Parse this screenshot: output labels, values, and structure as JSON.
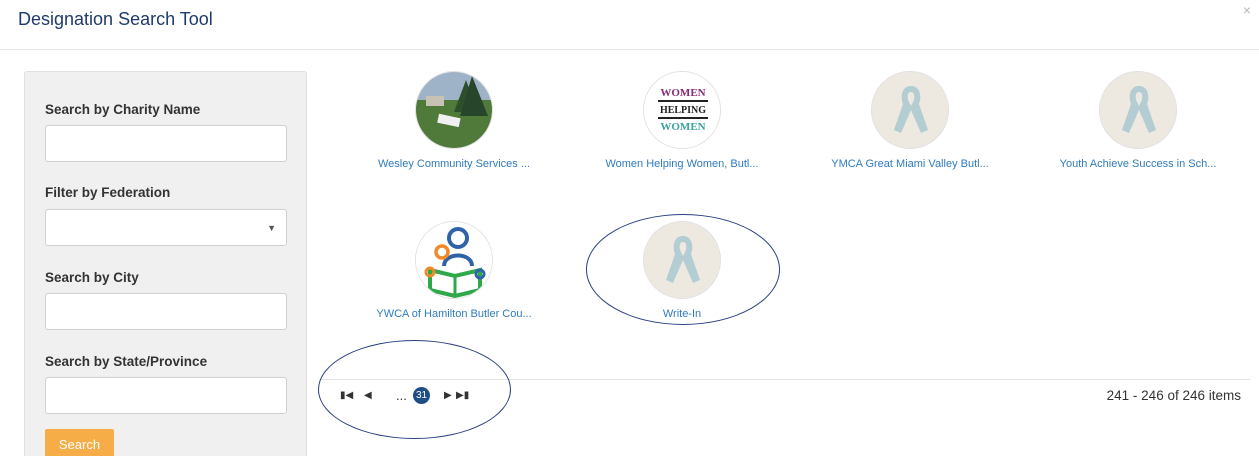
{
  "dialog": {
    "title": "Designation Search Tool",
    "close_label": "×"
  },
  "sidebar": {
    "charity_name_label": "Search by Charity Name",
    "charity_name_value": "",
    "federation_label": "Filter by Federation",
    "federation_value": "",
    "city_label": "Search by City",
    "city_value": "",
    "state_label": "Search by State/Province",
    "state_value": "",
    "search_button_label": "Search"
  },
  "results": [
    {
      "label": "Wesley Community Services ...",
      "image": "photo-sign-lawn"
    },
    {
      "label": "Women Helping Women, Butl...",
      "image": "women-helping-women-logo"
    },
    {
      "label": "YMCA Great Miami Valley Butl...",
      "image": "ribbon-icon"
    },
    {
      "label": "Youth Achieve Success in Sch...",
      "image": "ribbon-icon"
    },
    {
      "label": "YWCA of Hamilton Butler Cou...",
      "image": "reading-figures-logo"
    },
    {
      "label": "Write-In",
      "image": "ribbon-icon"
    }
  ],
  "logo_text": {
    "line1": "WOMEN",
    "line2": "HELPING",
    "line3": "WOMEN"
  },
  "pager": {
    "first_icon": "first-page-icon",
    "prev_icon": "prev-page-icon",
    "ellipsis": "...",
    "current_page": "31",
    "next_icon": "next-page-icon",
    "last_icon": "last-page-icon",
    "info": "241 - 246 of 246 items"
  },
  "colors": {
    "title": "#1f3a6b",
    "link": "#2f7bbd",
    "button": "#f6ad47",
    "page_current": "#1f4e87",
    "annotation": "#2a3f80"
  }
}
